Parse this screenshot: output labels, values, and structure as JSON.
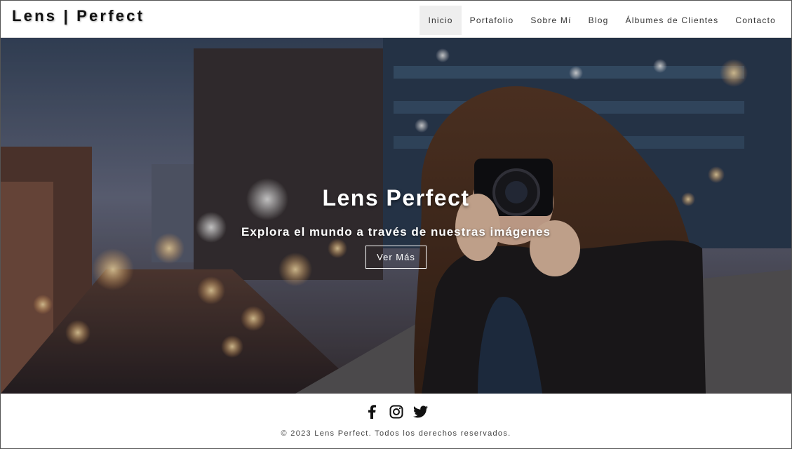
{
  "header": {
    "logo": "Lens | Perfect",
    "nav": [
      {
        "label": "Inicio",
        "active": true
      },
      {
        "label": "Portafolio",
        "active": false
      },
      {
        "label": "Sobre Mí",
        "active": false
      },
      {
        "label": "Blog",
        "active": false
      },
      {
        "label": "Álbumes de Clientes",
        "active": false
      },
      {
        "label": "Contacto",
        "active": false
      }
    ]
  },
  "hero": {
    "title": "Lens Perfect",
    "subtitle": "Explora el mundo a través de nuestras imágenes",
    "button_label": "Ver Más"
  },
  "footer": {
    "social": [
      {
        "icon": "facebook-icon"
      },
      {
        "icon": "instagram-icon"
      },
      {
        "icon": "twitter-icon"
      }
    ],
    "copyright": "© 2023 Lens Perfect. Todos los derechos reservados."
  },
  "colors": {
    "text_dark": "#111111",
    "nav_active_bg": "#eeeeee",
    "hero_text": "#ffffff"
  }
}
